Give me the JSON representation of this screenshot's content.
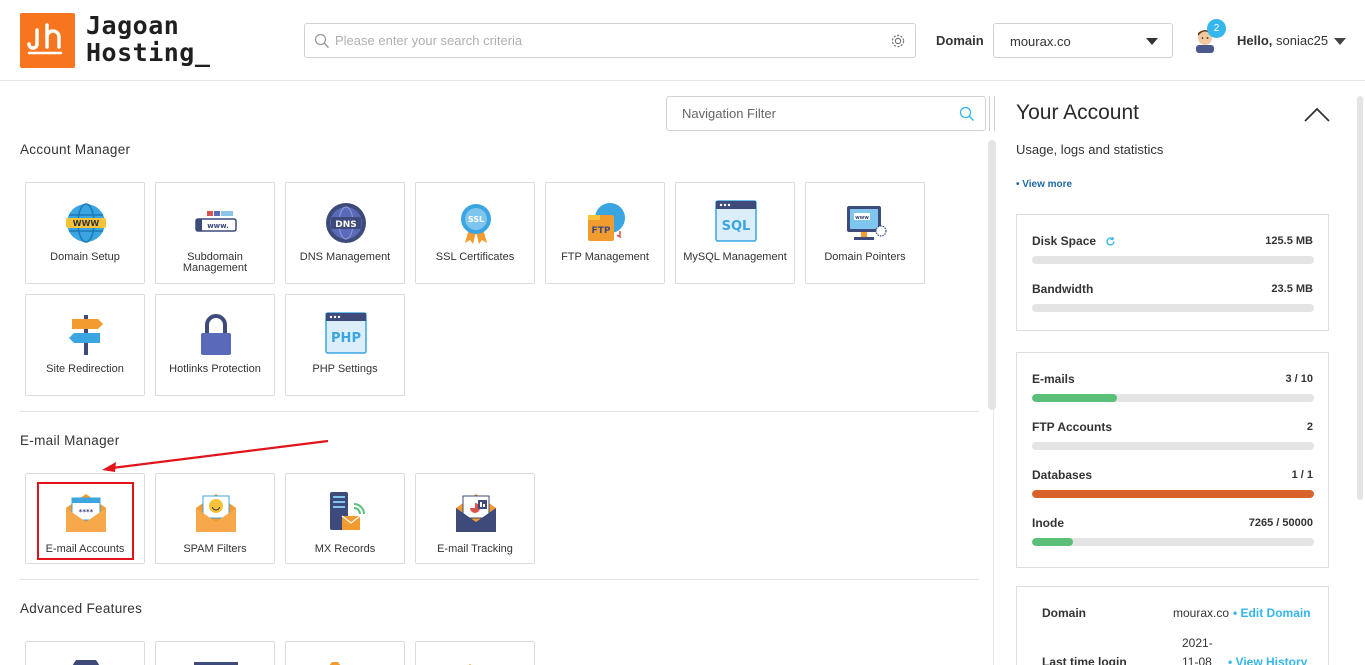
{
  "brand": {
    "name_line1": "Jagoan",
    "name_line2": "Hosting_",
    "accent": "#f7751f"
  },
  "header": {
    "search_placeholder": "Please enter your search criteria",
    "domain_label": "Domain",
    "domain_value": "mourax.co",
    "notification_count": "2",
    "hello_prefix": "Hello,",
    "username": "soniac25"
  },
  "nav_filter_placeholder": "Navigation Filter",
  "sections": {
    "account_manager": {
      "title": "Account Manager",
      "tiles": [
        {
          "label": "Domain Setup",
          "icon": "www-globe-icon"
        },
        {
          "label": "Subdomain Management",
          "icon": "subdomain-icon"
        },
        {
          "label": "DNS Management",
          "icon": "dns-icon"
        },
        {
          "label": "SSL Certificates",
          "icon": "ssl-badge-icon"
        },
        {
          "label": "FTP Management",
          "icon": "ftp-icon"
        },
        {
          "label": "MySQL Management",
          "icon": "sql-icon"
        },
        {
          "label": "Domain Pointers",
          "icon": "domain-pointer-icon"
        },
        {
          "label": "Site Redirection",
          "icon": "signpost-icon"
        },
        {
          "label": "Hotlinks Protection",
          "icon": "padlock-icon"
        },
        {
          "label": "PHP Settings",
          "icon": "php-icon"
        }
      ]
    },
    "email_manager": {
      "title": "E-mail Manager",
      "tiles": [
        {
          "label": "E-mail Accounts",
          "icon": "email-envelope-icon"
        },
        {
          "label": "SPAM Filters",
          "icon": "spam-filter-icon"
        },
        {
          "label": "MX Records",
          "icon": "mx-records-icon"
        },
        {
          "label": "E-mail Tracking",
          "icon": "email-tracking-icon"
        }
      ]
    },
    "advanced_features": {
      "title": "Advanced Features"
    }
  },
  "your_account": {
    "title": "Your Account",
    "subtitle": "Usage, logs and statistics",
    "view_more": "• View more",
    "usage": [
      {
        "label": "Disk Space",
        "value": "125.5 MB",
        "fraction": 0,
        "color": "#5bbf7a"
      },
      {
        "label": "Bandwidth",
        "value": "23.5 MB",
        "fraction": 0,
        "color": "#5bbf7a"
      }
    ],
    "limits": [
      {
        "label": "E-mails",
        "value": "3 / 10",
        "fraction": 0.3,
        "color": "#5bbf7a"
      },
      {
        "label": "FTP Accounts",
        "value": "2",
        "fraction": 0,
        "color": "#5bbf7a"
      },
      {
        "label": "Databases",
        "value": "1 / 1",
        "fraction": 1,
        "color": "#d9612a"
      },
      {
        "label": "Inode",
        "value": "7265 / 50000",
        "fraction": 0.1453,
        "color": "#5bbf7a"
      }
    ],
    "info": {
      "domain_label": "Domain",
      "domain_value": "mourax.co",
      "edit_domain": "• Edit Domain",
      "last_login_label": "Last time login",
      "last_login_line1": "2021-",
      "last_login_line2": "11-08",
      "view_history": "• View History"
    }
  }
}
